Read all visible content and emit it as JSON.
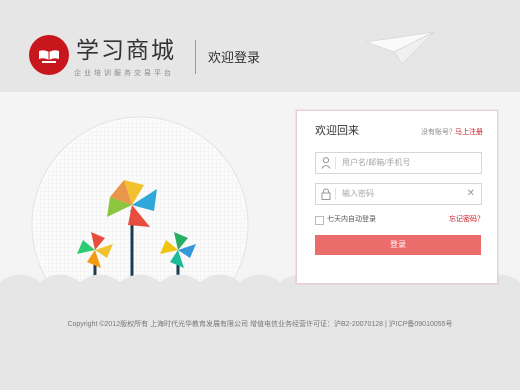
{
  "header": {
    "logo_title": "学习商城",
    "logo_subtitle": "企业培训服务交易平台",
    "welcome_login": "欢迎登录"
  },
  "login_panel": {
    "title": "欢迎回来",
    "no_account": "没有账号？",
    "register": "马上注册",
    "username_placeholder": "用户名/邮箱/手机号",
    "password_placeholder": "输入密码",
    "clear": "✕",
    "remember": "七天内自动登录",
    "forgot": "忘记密码？",
    "login_button": "登录"
  },
  "footer": {
    "copyright": "Copyright ©2012版权所有 上海时代光华教育发展有限公司 增值电信业务经营许可证：沪B2-20070128 | 沪ICP备09010055号"
  },
  "colors": {
    "brand_red": "#c8161d",
    "login_button": "#ec6b6b",
    "background": "#e6e6e6"
  },
  "icons": {
    "logo": "book-icon",
    "plane": "paper-plane-icon",
    "user": "user-icon",
    "lock": "lock-icon"
  }
}
